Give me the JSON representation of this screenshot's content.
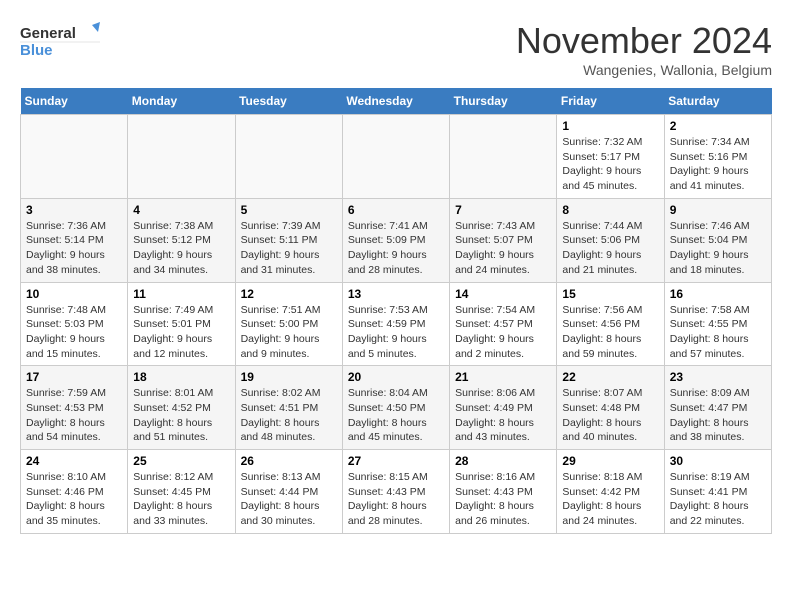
{
  "logo": {
    "line1": "General",
    "line2": "Blue"
  },
  "title": "November 2024",
  "subtitle": "Wangenies, Wallonia, Belgium",
  "days_of_week": [
    "Sunday",
    "Monday",
    "Tuesday",
    "Wednesday",
    "Thursday",
    "Friday",
    "Saturday"
  ],
  "weeks": [
    [
      {
        "day": "",
        "info": ""
      },
      {
        "day": "",
        "info": ""
      },
      {
        "day": "",
        "info": ""
      },
      {
        "day": "",
        "info": ""
      },
      {
        "day": "",
        "info": ""
      },
      {
        "day": "1",
        "info": "Sunrise: 7:32 AM\nSunset: 5:17 PM\nDaylight: 9 hours and 45 minutes."
      },
      {
        "day": "2",
        "info": "Sunrise: 7:34 AM\nSunset: 5:16 PM\nDaylight: 9 hours and 41 minutes."
      }
    ],
    [
      {
        "day": "3",
        "info": "Sunrise: 7:36 AM\nSunset: 5:14 PM\nDaylight: 9 hours and 38 minutes."
      },
      {
        "day": "4",
        "info": "Sunrise: 7:38 AM\nSunset: 5:12 PM\nDaylight: 9 hours and 34 minutes."
      },
      {
        "day": "5",
        "info": "Sunrise: 7:39 AM\nSunset: 5:11 PM\nDaylight: 9 hours and 31 minutes."
      },
      {
        "day": "6",
        "info": "Sunrise: 7:41 AM\nSunset: 5:09 PM\nDaylight: 9 hours and 28 minutes."
      },
      {
        "day": "7",
        "info": "Sunrise: 7:43 AM\nSunset: 5:07 PM\nDaylight: 9 hours and 24 minutes."
      },
      {
        "day": "8",
        "info": "Sunrise: 7:44 AM\nSunset: 5:06 PM\nDaylight: 9 hours and 21 minutes."
      },
      {
        "day": "9",
        "info": "Sunrise: 7:46 AM\nSunset: 5:04 PM\nDaylight: 9 hours and 18 minutes."
      }
    ],
    [
      {
        "day": "10",
        "info": "Sunrise: 7:48 AM\nSunset: 5:03 PM\nDaylight: 9 hours and 15 minutes."
      },
      {
        "day": "11",
        "info": "Sunrise: 7:49 AM\nSunset: 5:01 PM\nDaylight: 9 hours and 12 minutes."
      },
      {
        "day": "12",
        "info": "Sunrise: 7:51 AM\nSunset: 5:00 PM\nDaylight: 9 hours and 9 minutes."
      },
      {
        "day": "13",
        "info": "Sunrise: 7:53 AM\nSunset: 4:59 PM\nDaylight: 9 hours and 5 minutes."
      },
      {
        "day": "14",
        "info": "Sunrise: 7:54 AM\nSunset: 4:57 PM\nDaylight: 9 hours and 2 minutes."
      },
      {
        "day": "15",
        "info": "Sunrise: 7:56 AM\nSunset: 4:56 PM\nDaylight: 8 hours and 59 minutes."
      },
      {
        "day": "16",
        "info": "Sunrise: 7:58 AM\nSunset: 4:55 PM\nDaylight: 8 hours and 57 minutes."
      }
    ],
    [
      {
        "day": "17",
        "info": "Sunrise: 7:59 AM\nSunset: 4:53 PM\nDaylight: 8 hours and 54 minutes."
      },
      {
        "day": "18",
        "info": "Sunrise: 8:01 AM\nSunset: 4:52 PM\nDaylight: 8 hours and 51 minutes."
      },
      {
        "day": "19",
        "info": "Sunrise: 8:02 AM\nSunset: 4:51 PM\nDaylight: 8 hours and 48 minutes."
      },
      {
        "day": "20",
        "info": "Sunrise: 8:04 AM\nSunset: 4:50 PM\nDaylight: 8 hours and 45 minutes."
      },
      {
        "day": "21",
        "info": "Sunrise: 8:06 AM\nSunset: 4:49 PM\nDaylight: 8 hours and 43 minutes."
      },
      {
        "day": "22",
        "info": "Sunrise: 8:07 AM\nSunset: 4:48 PM\nDaylight: 8 hours and 40 minutes."
      },
      {
        "day": "23",
        "info": "Sunrise: 8:09 AM\nSunset: 4:47 PM\nDaylight: 8 hours and 38 minutes."
      }
    ],
    [
      {
        "day": "24",
        "info": "Sunrise: 8:10 AM\nSunset: 4:46 PM\nDaylight: 8 hours and 35 minutes."
      },
      {
        "day": "25",
        "info": "Sunrise: 8:12 AM\nSunset: 4:45 PM\nDaylight: 8 hours and 33 minutes."
      },
      {
        "day": "26",
        "info": "Sunrise: 8:13 AM\nSunset: 4:44 PM\nDaylight: 8 hours and 30 minutes."
      },
      {
        "day": "27",
        "info": "Sunrise: 8:15 AM\nSunset: 4:43 PM\nDaylight: 8 hours and 28 minutes."
      },
      {
        "day": "28",
        "info": "Sunrise: 8:16 AM\nSunset: 4:43 PM\nDaylight: 8 hours and 26 minutes."
      },
      {
        "day": "29",
        "info": "Sunrise: 8:18 AM\nSunset: 4:42 PM\nDaylight: 8 hours and 24 minutes."
      },
      {
        "day": "30",
        "info": "Sunrise: 8:19 AM\nSunset: 4:41 PM\nDaylight: 8 hours and 22 minutes."
      }
    ]
  ]
}
